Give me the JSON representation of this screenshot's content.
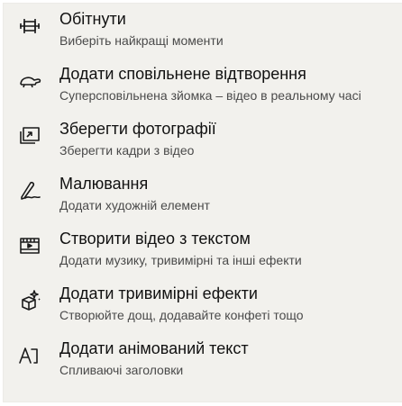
{
  "menu": {
    "items": [
      {
        "icon": "trim-icon",
        "title": "Обітнути",
        "subtitle": "Виберіть найкращі моменти"
      },
      {
        "icon": "turtle-slow-motion-icon",
        "title": "Додати сповільнене відтворення",
        "subtitle": "Суперсповільнена зйомка – відео в реальному часі"
      },
      {
        "icon": "save-photos-icon",
        "title": "Зберегти фотографії",
        "subtitle": "Зберегти кадри з відео"
      },
      {
        "icon": "pen-drawing-icon",
        "title": "Малювання",
        "subtitle": "Додати художній елемент"
      },
      {
        "icon": "video-from-text-icon",
        "title": "Створити відео з текстом",
        "subtitle": "Додати музику, тривимірні та інші ефекти"
      },
      {
        "icon": "3d-effects-icon",
        "title": "Додати тривимірні ефекти",
        "subtitle": "Створюйте дощ, додавайте конфеті тощо"
      },
      {
        "icon": "animated-text-icon",
        "title": "Додати анімований текст",
        "subtitle": "Спливаючі заголовки"
      }
    ]
  }
}
